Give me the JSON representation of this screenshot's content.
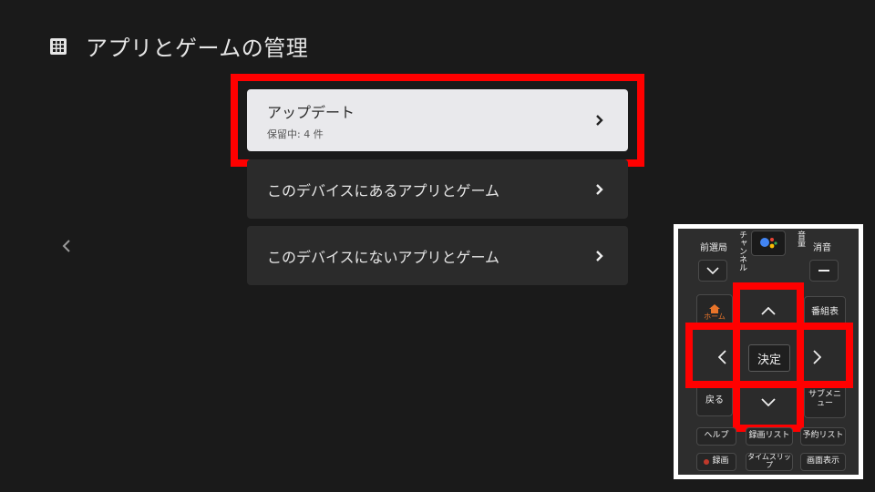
{
  "header": {
    "title": "アプリとゲームの管理",
    "icon": "apps-grid-icon"
  },
  "menu": {
    "items": [
      {
        "label": "アップデート",
        "sublabel": "保留中: 4 件",
        "focused": true
      },
      {
        "label": "このデバイスにあるアプリとゲーム",
        "sublabel": "",
        "focused": false
      },
      {
        "label": "このデバイスにないアプリとゲーム",
        "sublabel": "",
        "focused": false
      }
    ]
  },
  "remote": {
    "labels": {
      "zensenkyoku": "前選局",
      "channel": "チャンネル",
      "volume": "音量",
      "mute": "消音",
      "home": "ホーム",
      "bangumi": "番組表",
      "kettei": "決定",
      "back": "戻る",
      "submenu": "サブメニュー",
      "help": "ヘルプ",
      "rokuga_list": "録画リスト",
      "yoyaku_list": "予約リスト",
      "rokuga": "録画",
      "timeslip": "タイムスリップ",
      "gamen_hyouji": "画面表示"
    }
  },
  "colors": {
    "background": "#1a1a1a",
    "highlight": "#ff0000",
    "focused_item": "#e9e9ec",
    "item": "#2b2b2b"
  }
}
